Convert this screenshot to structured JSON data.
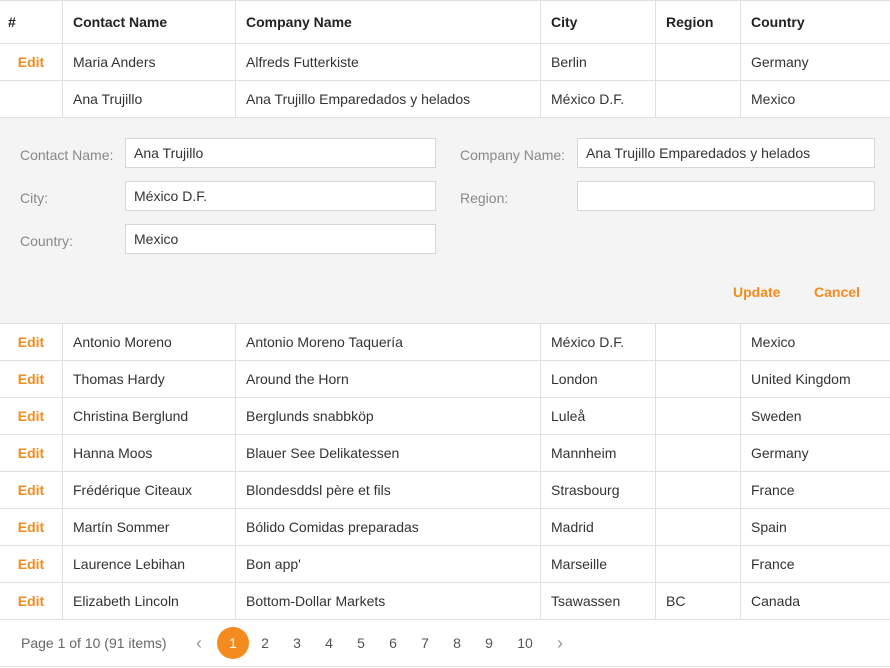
{
  "columns": [
    "#",
    "Contact Name",
    "Company Name",
    "City",
    "Region",
    "Country"
  ],
  "edit_label": "Edit",
  "rows_before": [
    {
      "edit": "Edit",
      "contact": "Maria Anders",
      "company": "Alfreds Futterkiste",
      "city": "Berlin",
      "region": "",
      "country": "Germany"
    },
    {
      "edit": "",
      "contact": "Ana Trujillo",
      "company": "Ana Trujillo Emparedados y helados",
      "city": "México D.F.",
      "region": "",
      "country": "Mexico"
    }
  ],
  "edit_form": {
    "contact_label": "Contact Name:",
    "contact_value": "Ana Trujillo",
    "company_label": "Company Name:",
    "company_value": "Ana Trujillo Emparedados y helados",
    "city_label": "City:",
    "city_value": "México D.F.",
    "region_label": "Region:",
    "region_value": "",
    "country_label": "Country:",
    "country_value": "Mexico",
    "update_label": "Update",
    "cancel_label": "Cancel"
  },
  "rows_after": [
    {
      "edit": "Edit",
      "contact": "Antonio Moreno",
      "company": "Antonio Moreno Taquería",
      "city": "México D.F.",
      "region": "",
      "country": "Mexico"
    },
    {
      "edit": "Edit",
      "contact": "Thomas Hardy",
      "company": "Around the Horn",
      "city": "London",
      "region": "",
      "country": "United Kingdom"
    },
    {
      "edit": "Edit",
      "contact": "Christina Berglund",
      "company": "Berglunds snabbköp",
      "city": "Luleå",
      "region": "",
      "country": "Sweden"
    },
    {
      "edit": "Edit",
      "contact": "Hanna Moos",
      "company": "Blauer See Delikatessen",
      "city": "Mannheim",
      "region": "",
      "country": "Germany"
    },
    {
      "edit": "Edit",
      "contact": "Frédérique Citeaux",
      "company": "Blondesddsl père et fils",
      "city": "Strasbourg",
      "region": "",
      "country": "France"
    },
    {
      "edit": "Edit",
      "contact": "Martín Sommer",
      "company": "Bólido Comidas preparadas",
      "city": "Madrid",
      "region": "",
      "country": "Spain"
    },
    {
      "edit": "Edit",
      "contact": "Laurence Lebihan",
      "company": "Bon app'",
      "city": "Marseille",
      "region": "",
      "country": "France"
    },
    {
      "edit": "Edit",
      "contact": "Elizabeth Lincoln",
      "company": "Bottom-Dollar Markets",
      "city": "Tsawassen",
      "region": "BC",
      "country": "Canada"
    }
  ],
  "pager": {
    "info": "Page 1 of 10 (91 items)",
    "prev_icon": "chevron-left-icon",
    "next_icon": "chevron-right-icon",
    "prev_glyph": "‹",
    "next_glyph": "›",
    "pages": [
      "1",
      "2",
      "3",
      "4",
      "5",
      "6",
      "7",
      "8",
      "9",
      "10"
    ],
    "current": "1"
  },
  "colors": {
    "accent": "#f38b1f",
    "form_bg": "#f4f4f4",
    "border": "#e0e0e0"
  }
}
